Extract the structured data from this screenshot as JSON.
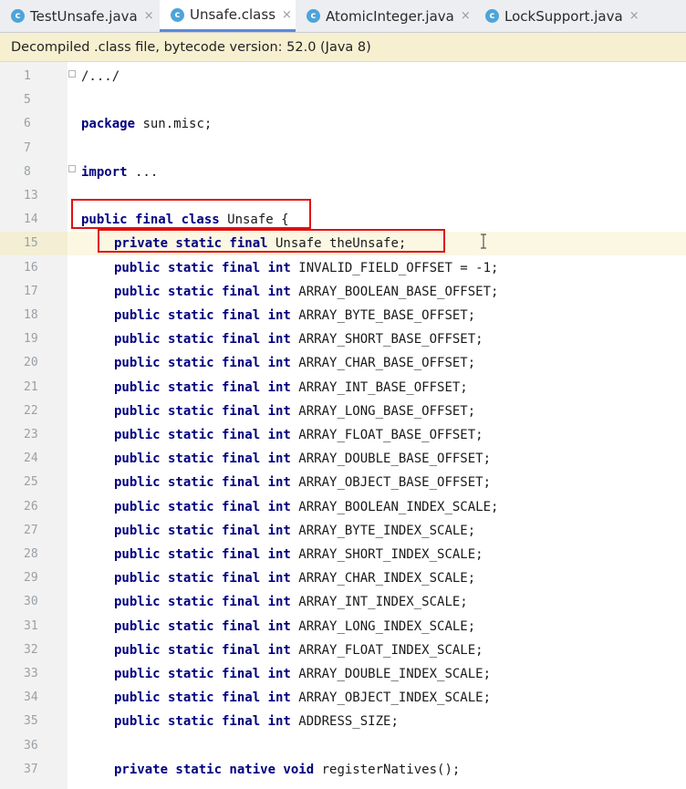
{
  "tabs": [
    {
      "label": "TestUnsafe.java",
      "active": false,
      "icon": "class-c-icon"
    },
    {
      "label": "Unsafe.class",
      "active": true,
      "icon": "class-c-icon"
    },
    {
      "label": "AtomicInteger.java",
      "active": false,
      "icon": "class-c-icon"
    },
    {
      "label": "LockSupport.java",
      "active": false,
      "icon": "class-c-icon"
    }
  ],
  "tab_icon_letter": "c",
  "close_glyph": "×",
  "banner": "Decompiled .class file, bytecode version: 52.0 (Java 8)",
  "code_lines": [
    {
      "n": "1",
      "indent": 0,
      "kw": "",
      "rest": "/.../"
    },
    {
      "n": "5",
      "indent": 0,
      "kw": "",
      "rest": ""
    },
    {
      "n": "6",
      "indent": 0,
      "kw": "package",
      "rest": " sun.misc;"
    },
    {
      "n": "7",
      "indent": 0,
      "kw": "",
      "rest": ""
    },
    {
      "n": "8",
      "indent": 0,
      "kw": "import",
      "rest": " ..."
    },
    {
      "n": "13",
      "indent": 0,
      "kw": "",
      "rest": ""
    },
    {
      "n": "14",
      "indent": 0,
      "kw": "public final class",
      "rest": " Unsafe {"
    },
    {
      "n": "15",
      "indent": 1,
      "kw": "private static final",
      "rest": " Unsafe theUnsafe;"
    },
    {
      "n": "16",
      "indent": 1,
      "kw": "public static final int",
      "rest": " INVALID_FIELD_OFFSET = -1;"
    },
    {
      "n": "17",
      "indent": 1,
      "kw": "public static final int",
      "rest": " ARRAY_BOOLEAN_BASE_OFFSET;"
    },
    {
      "n": "18",
      "indent": 1,
      "kw": "public static final int",
      "rest": " ARRAY_BYTE_BASE_OFFSET;"
    },
    {
      "n": "19",
      "indent": 1,
      "kw": "public static final int",
      "rest": " ARRAY_SHORT_BASE_OFFSET;"
    },
    {
      "n": "20",
      "indent": 1,
      "kw": "public static final int",
      "rest": " ARRAY_CHAR_BASE_OFFSET;"
    },
    {
      "n": "21",
      "indent": 1,
      "kw": "public static final int",
      "rest": " ARRAY_INT_BASE_OFFSET;"
    },
    {
      "n": "22",
      "indent": 1,
      "kw": "public static final int",
      "rest": " ARRAY_LONG_BASE_OFFSET;"
    },
    {
      "n": "23",
      "indent": 1,
      "kw": "public static final int",
      "rest": " ARRAY_FLOAT_BASE_OFFSET;"
    },
    {
      "n": "24",
      "indent": 1,
      "kw": "public static final int",
      "rest": " ARRAY_DOUBLE_BASE_OFFSET;"
    },
    {
      "n": "25",
      "indent": 1,
      "kw": "public static final int",
      "rest": " ARRAY_OBJECT_BASE_OFFSET;"
    },
    {
      "n": "26",
      "indent": 1,
      "kw": "public static final int",
      "rest": " ARRAY_BOOLEAN_INDEX_SCALE;"
    },
    {
      "n": "27",
      "indent": 1,
      "kw": "public static final int",
      "rest": " ARRAY_BYTE_INDEX_SCALE;"
    },
    {
      "n": "28",
      "indent": 1,
      "kw": "public static final int",
      "rest": " ARRAY_SHORT_INDEX_SCALE;"
    },
    {
      "n": "29",
      "indent": 1,
      "kw": "public static final int",
      "rest": " ARRAY_CHAR_INDEX_SCALE;"
    },
    {
      "n": "30",
      "indent": 1,
      "kw": "public static final int",
      "rest": " ARRAY_INT_INDEX_SCALE;"
    },
    {
      "n": "31",
      "indent": 1,
      "kw": "public static final int",
      "rest": " ARRAY_LONG_INDEX_SCALE;"
    },
    {
      "n": "32",
      "indent": 1,
      "kw": "public static final int",
      "rest": " ARRAY_FLOAT_INDEX_SCALE;"
    },
    {
      "n": "33",
      "indent": 1,
      "kw": "public static final int",
      "rest": " ARRAY_DOUBLE_INDEX_SCALE;"
    },
    {
      "n": "34",
      "indent": 1,
      "kw": "public static final int",
      "rest": " ARRAY_OBJECT_INDEX_SCALE;"
    },
    {
      "n": "35",
      "indent": 1,
      "kw": "public static final int",
      "rest": " ADDRESS_SIZE;"
    },
    {
      "n": "36",
      "indent": 0,
      "kw": "",
      "rest": ""
    },
    {
      "n": "37",
      "indent": 1,
      "kw": "private static native void",
      "rest": " registerNatives();"
    }
  ],
  "current_line": "15",
  "highlight_color": "#e01010",
  "keyword_color": "#000080"
}
